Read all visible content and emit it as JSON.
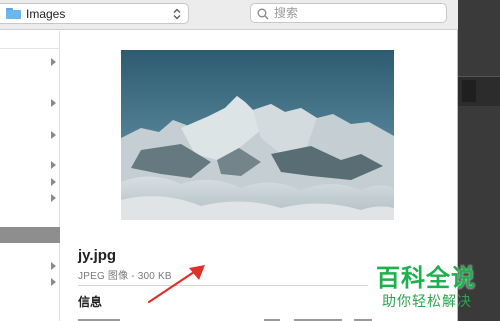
{
  "toolbar": {
    "location": "Images",
    "search_placeholder": "搜索"
  },
  "column": {
    "rows": [
      {
        "has_arrow": true
      },
      {
        "has_arrow": true
      },
      {
        "has_arrow": true
      },
      {
        "has_arrow": true
      },
      {
        "has_arrow": true
      },
      {
        "has_arrow": true
      },
      {
        "has_arrow": false,
        "selected": true
      },
      {
        "has_arrow": true
      },
      {
        "has_arrow": true
      }
    ]
  },
  "preview": {
    "file_name": "jy.jpg",
    "file_kind": "JPEG 图像 - 300 KB",
    "info_heading": "信息"
  },
  "watermark": {
    "title": "百科全说",
    "subtitle": "助你轻松解决"
  },
  "colors": {
    "accent_arrow": "#e0302a",
    "watermark_green": "#1fb04e",
    "selection_gray": "#8e8e8e"
  }
}
